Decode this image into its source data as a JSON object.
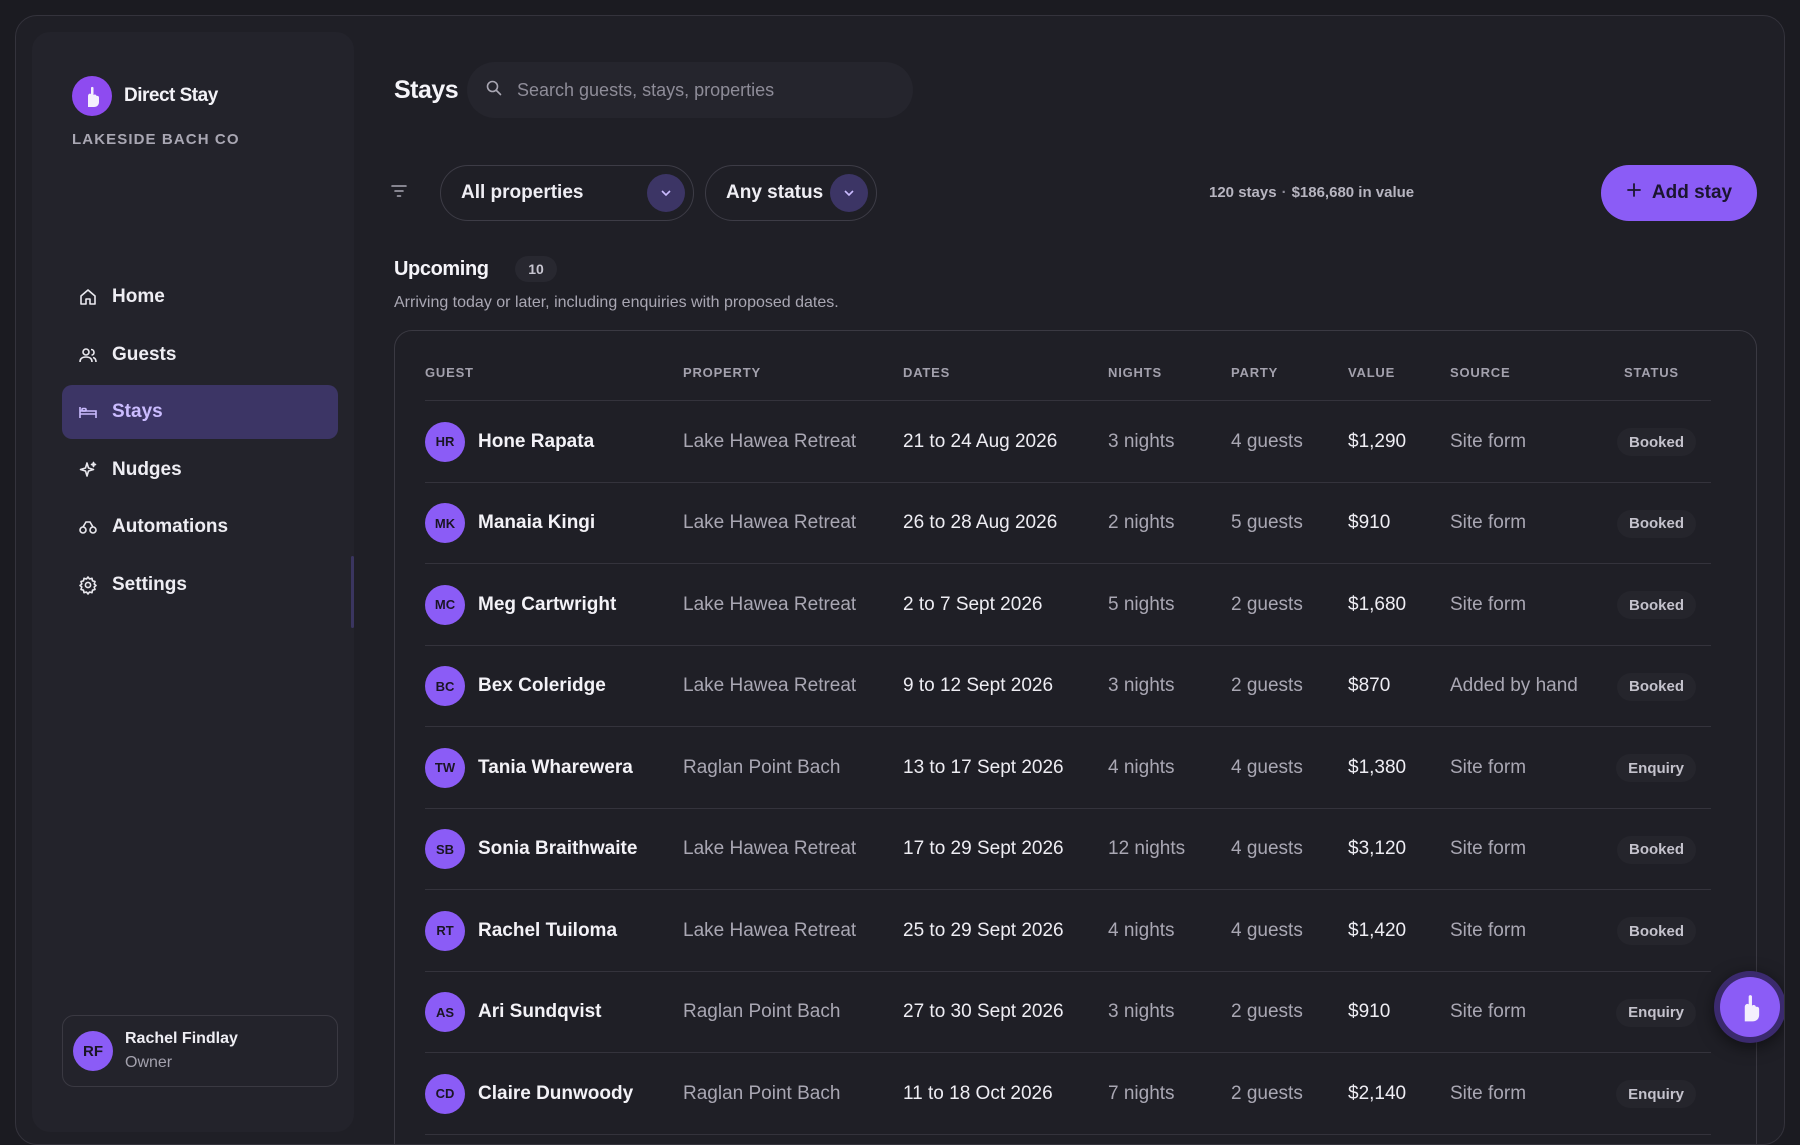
{
  "brand": {
    "name": "Direct Stay",
    "org": "LAKESIDE BACH CO"
  },
  "nav": [
    {
      "label": "Home",
      "icon": "home-icon"
    },
    {
      "label": "Guests",
      "icon": "users-icon"
    },
    {
      "label": "Stays",
      "icon": "bed-icon",
      "active": true
    },
    {
      "label": "Nudges",
      "icon": "sparkle-icon"
    },
    {
      "label": "Automations",
      "icon": "automation-icon"
    },
    {
      "label": "Settings",
      "icon": "gear-icon"
    }
  ],
  "user": {
    "initials": "RF",
    "name": "Rachel Findlay",
    "role": "Owner"
  },
  "header": {
    "title": "Stays",
    "search_placeholder": "Search guests, stays, properties"
  },
  "filters": {
    "property": "All properties",
    "status": "Any status"
  },
  "summary": {
    "stays": "120 stays",
    "value": "$186,680 in value"
  },
  "add_button": "Add stay",
  "section": {
    "title": "Upcoming",
    "count": "10",
    "subtitle": "Arriving today or later, including enquiries with proposed dates."
  },
  "table": {
    "columns": [
      "GUEST",
      "PROPERTY",
      "DATES",
      "NIGHTS",
      "PARTY",
      "VALUE",
      "SOURCE",
      "STATUS"
    ],
    "rows": [
      {
        "initials": "HR",
        "guest": "Hone Rapata",
        "property": "Lake Hawea Retreat",
        "dates": "21 to 24 Aug 2026",
        "nights": "3 nights",
        "party": "4 guests",
        "value": "$1,290",
        "source": "Site form",
        "status": "Booked"
      },
      {
        "initials": "MK",
        "guest": "Manaia Kingi",
        "property": "Lake Hawea Retreat",
        "dates": "26 to 28 Aug 2026",
        "nights": "2 nights",
        "party": "5 guests",
        "value": "$910",
        "source": "Site form",
        "status": "Booked"
      },
      {
        "initials": "MC",
        "guest": "Meg Cartwright",
        "property": "Lake Hawea Retreat",
        "dates": "2 to 7 Sept 2026",
        "nights": "5 nights",
        "party": "2 guests",
        "value": "$1,680",
        "source": "Site form",
        "status": "Booked"
      },
      {
        "initials": "BC",
        "guest": "Bex Coleridge",
        "property": "Lake Hawea Retreat",
        "dates": "9 to 12 Sept 2026",
        "nights": "3 nights",
        "party": "2 guests",
        "value": "$870",
        "source": "Added by hand",
        "status": "Booked"
      },
      {
        "initials": "TW",
        "guest": "Tania Wharewera",
        "property": "Raglan Point Bach",
        "dates": "13 to 17 Sept 2026",
        "nights": "4 nights",
        "party": "4 guests",
        "value": "$1,380",
        "source": "Site form",
        "status": "Enquiry"
      },
      {
        "initials": "SB",
        "guest": "Sonia Braithwaite",
        "property": "Lake Hawea Retreat",
        "dates": "17 to 29 Sept 2026",
        "nights": "12 nights",
        "party": "4 guests",
        "value": "$3,120",
        "source": "Site form",
        "status": "Booked"
      },
      {
        "initials": "RT",
        "guest": "Rachel Tuiloma",
        "property": "Lake Hawea Retreat",
        "dates": "25 to 29 Sept 2026",
        "nights": "4 nights",
        "party": "4 guests",
        "value": "$1,420",
        "source": "Site form",
        "status": "Booked"
      },
      {
        "initials": "AS",
        "guest": "Ari Sundqvist",
        "property": "Raglan Point Bach",
        "dates": "27 to 30 Sept 2026",
        "nights": "3 nights",
        "party": "2 guests",
        "value": "$910",
        "source": "Site form",
        "status": "Enquiry"
      },
      {
        "initials": "CD",
        "guest": "Claire Dunwoody",
        "property": "Raglan Point Bach",
        "dates": "11 to 18 Oct 2026",
        "nights": "7 nights",
        "party": "2 guests",
        "value": "$2,140",
        "source": "Site form",
        "status": "Enquiry"
      }
    ]
  },
  "colors": {
    "accent": "#8b5cf6",
    "active_nav_bg": "#3c3565",
    "background": "#1f1f26"
  }
}
